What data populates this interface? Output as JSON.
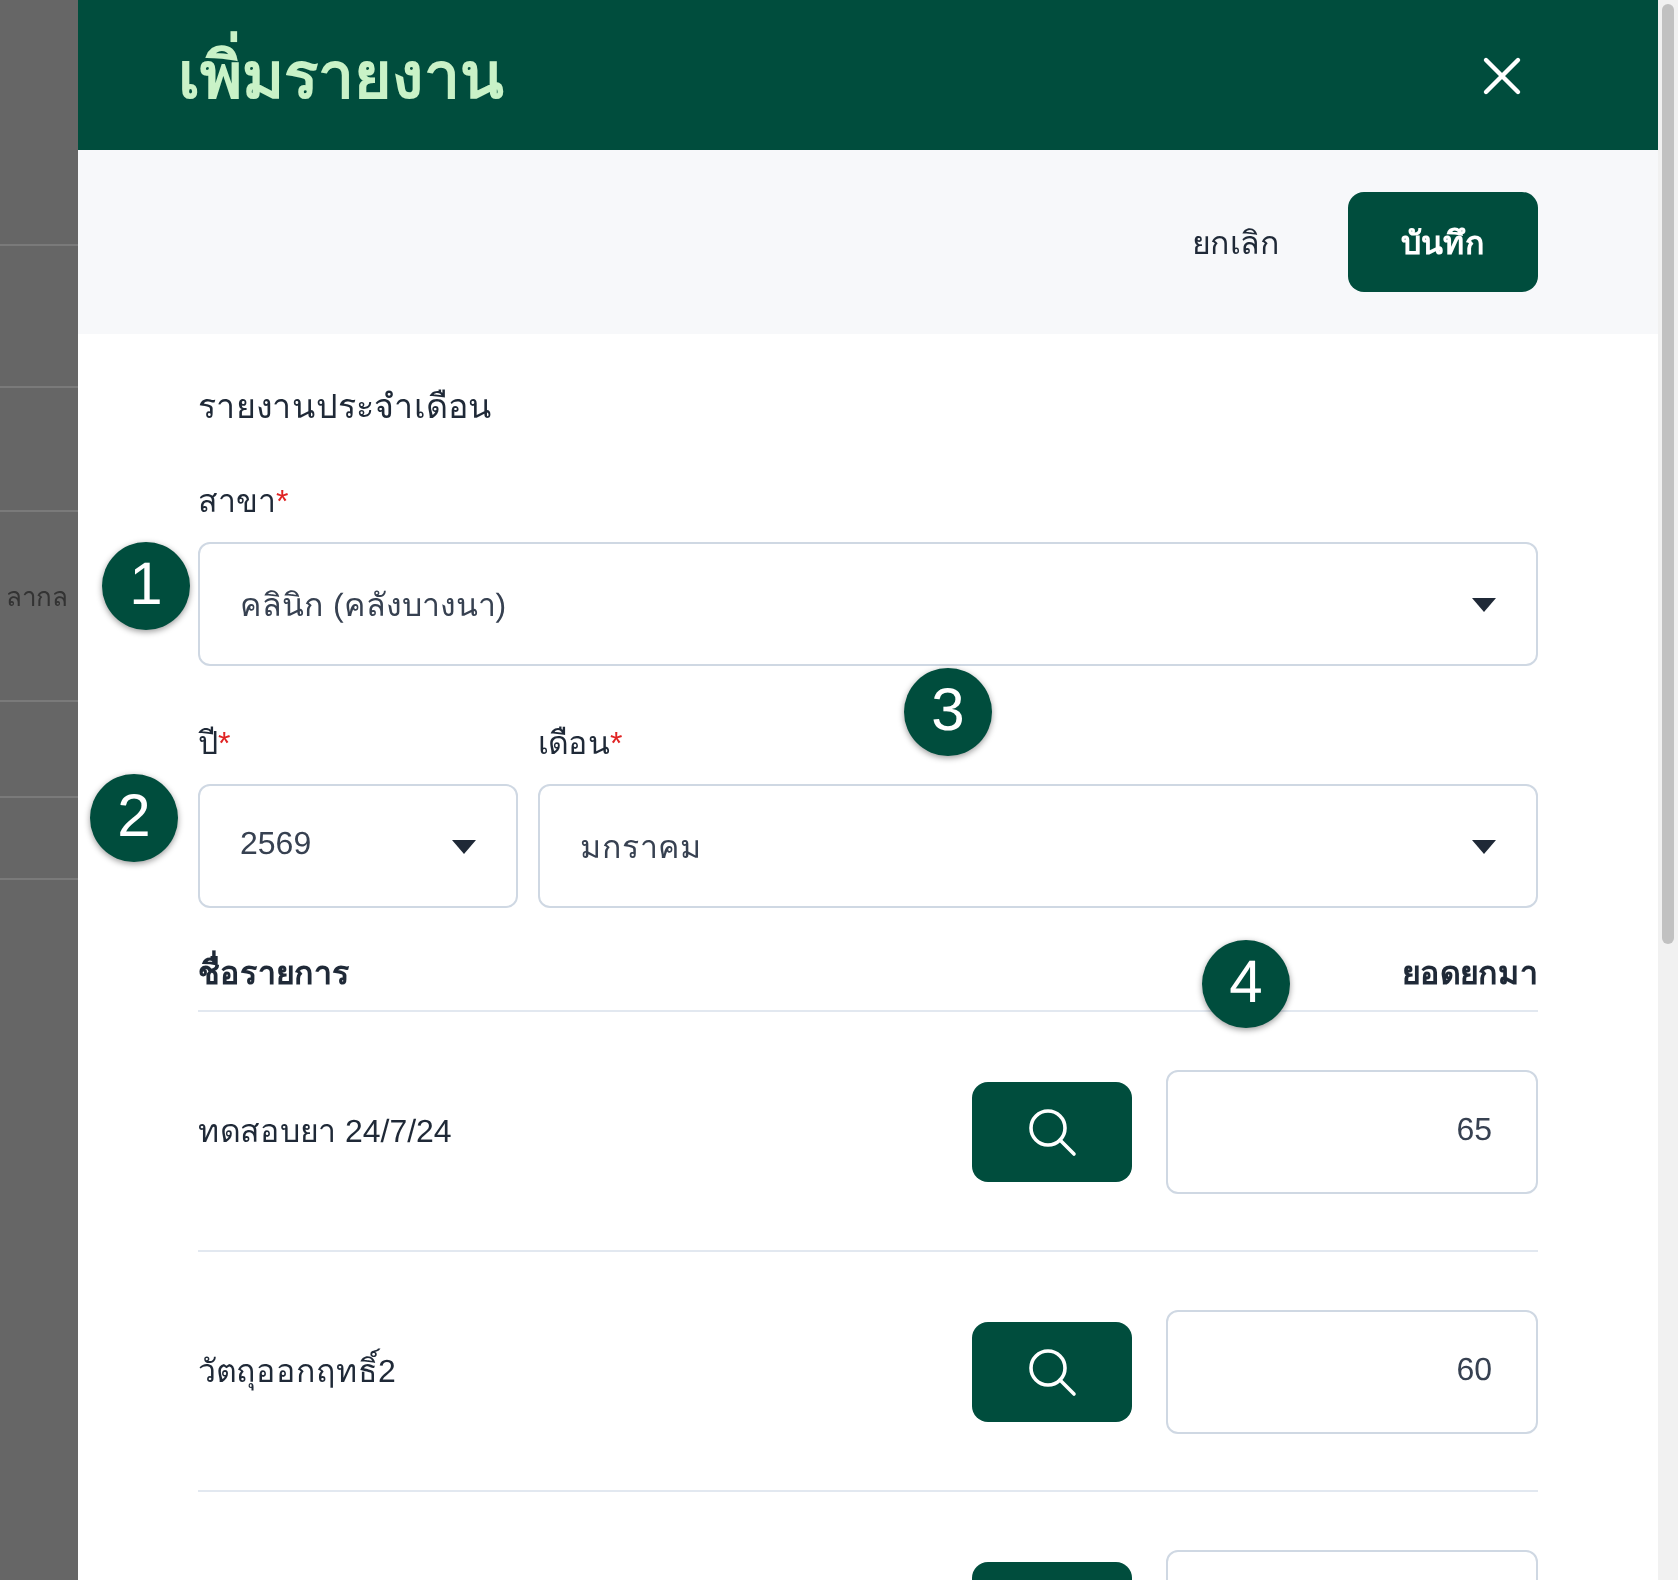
{
  "background": {
    "text": "ลากล"
  },
  "drawer": {
    "title": "เพิ่มรายงาน"
  },
  "actions": {
    "cancel": "ยกเลิก",
    "save": "บันทึก"
  },
  "section_title": "รายงานประจำเดือน",
  "required_mark": "*",
  "fields": [
    {
      "label": "สาขา",
      "required": true,
      "value": "คลินิก (คลังบางนา)"
    },
    {
      "label": "ปี",
      "required": true,
      "value": "2569"
    },
    {
      "label": "เดือน",
      "required": true,
      "value": "มกราคม"
    }
  ],
  "table": {
    "columns": [
      "ชื่อรายการ",
      "ยอดยกมา"
    ],
    "rows": [
      {
        "name": "ทดสอบยา 24/7/24",
        "value": "65"
      },
      {
        "name": "วัตถุออกฤทธิ์2",
        "value": "60"
      },
      {}
    ]
  },
  "callouts": [
    "1",
    "2",
    "3",
    "4"
  ]
}
